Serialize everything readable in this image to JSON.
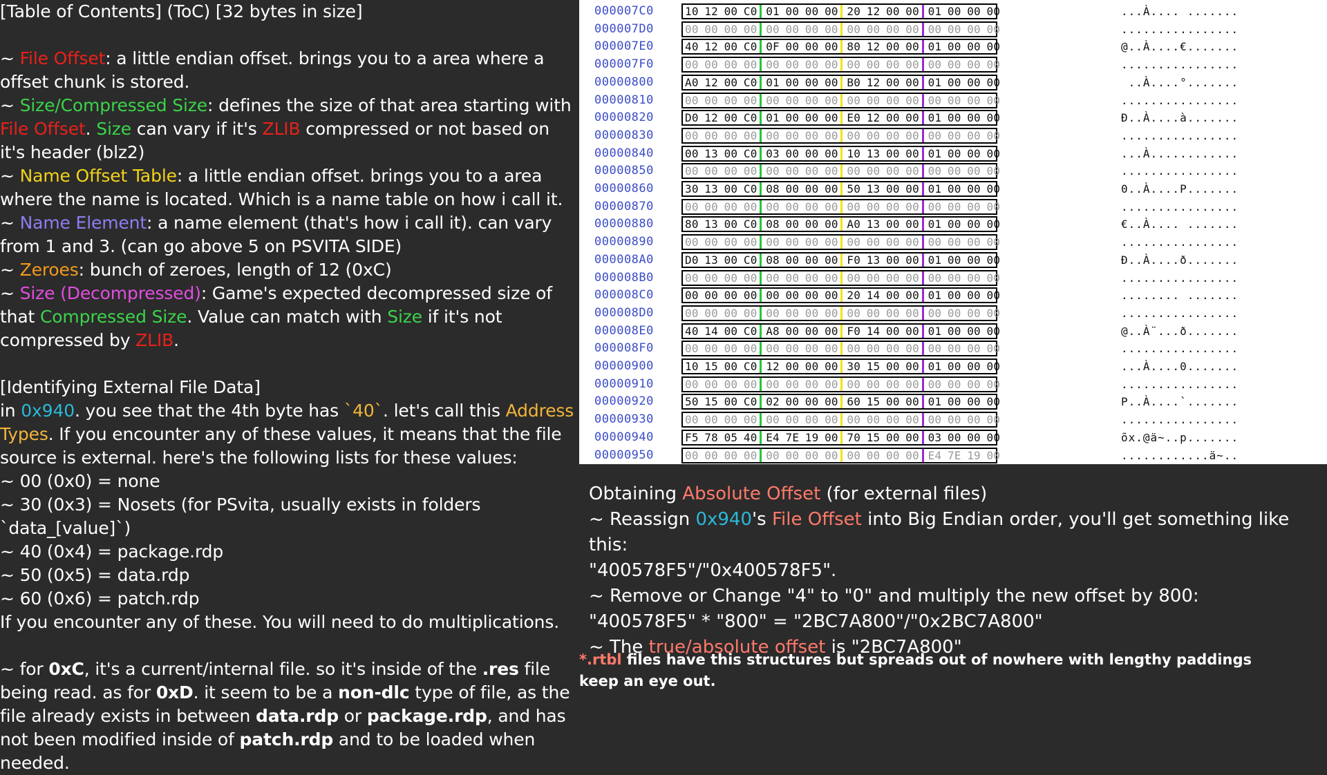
{
  "left_text": {
    "toc_header": "[Table of Contents] (ToC) [32 bytes in size]",
    "file_offset_term": "File Offset",
    "file_offset_desc": ": a little endian offset. brings you to a area where a offset chunk is stored.",
    "size_term": "Size/Compressed Size",
    "size_desc_1": ": defines the size of that area starting with ",
    "size_file_offset": "File Offset",
    "size_dot": ". ",
    "size_word": "Size",
    "size_desc_2": " can vary if it's ",
    "size_zlib": "ZLIB",
    "size_desc_3": " compressed or not based on it's header (blz2)",
    "name_offset_term": "Name Offset Table",
    "name_offset_desc": ": a little endian offset. brings you to a area where the name is located. Which is a name table on how i call it.",
    "name_element_term": "Name Element",
    "name_element_desc": ": a name element (that's how i call it). can vary from 1 and 3. (can go above 5 on PSVITA SIDE)",
    "zeroes_term": "Zeroes",
    "zeroes_desc": ": bunch of zeroes, length of 12 (0xC)",
    "decomp_term": "Size (Decompressed)",
    "decomp_desc_1": ": Game's expected decompressed size of that ",
    "decomp_compressed": "Compressed Size",
    "decomp_desc_2": ". Value can match with ",
    "decomp_size": "Size",
    "decomp_desc_3": " if it's not compressed by ",
    "decomp_zlib": "ZLIB",
    "decomp_end": ".",
    "ext_header": "[Identifying External File Data]",
    "ext_in": "in ",
    "ext_addr": "0x940",
    "ext_1": ". you see that the 4th byte has ",
    "ext_40": "`40`",
    "ext_2": ". let's call this ",
    "ext_addr_types": "Address Types",
    "ext_3": ". If you encounter any of these values, it means that the file source is external. here's the following lists for these values:",
    "list": [
      "~ 00 (0x0) = none",
      "~ 30 (0x3) = Nosets (for PSvita, usually exists in folders `data_[value]`)",
      "~ 40 (0x4) = package.rdp",
      "~ 50 (0x5) = data.rdp",
      "~ 60 (0x6) = patch.rdp"
    ],
    "mult_note": "If you encounter any of these. You will need to do multiplications.",
    "oxc_1": "~ for ",
    "oxc_b1": "0xC",
    "oxc_2": ", it's a current/internal file. so it's inside of the ",
    "oxc_b2": ".res",
    "oxc_3": " file being read. as for ",
    "oxc_b3": "0xD",
    "oxc_4": ". it seem to be a ",
    "oxc_b4": "non-dlc",
    "oxc_5": " type of file, as the file already exists in between ",
    "oxc_b5": "data.rdp",
    "oxc_6": " or ",
    "oxc_b6": "package.rdp",
    "oxc_7": ", and has not been modified inside of ",
    "oxc_b7": "patch.rdp",
    "oxc_8": " and to be loaded when needed.",
    "tilde": "~ "
  },
  "hex_rows": [
    {
      "addr": "000007C0",
      "bytes": [
        "10",
        "12",
        "00",
        "C0",
        "01",
        "00",
        "00",
        "00",
        "20",
        "12",
        "00",
        "00",
        "01",
        "00",
        "00",
        "00"
      ],
      "ascii": "...À.... ......."
    },
    {
      "addr": "000007D0",
      "bytes": [
        "00",
        "00",
        "00",
        "00",
        "00",
        "00",
        "00",
        "00",
        "00",
        "00",
        "00",
        "00",
        "00",
        "00",
        "00",
        "00"
      ],
      "ascii": "................"
    },
    {
      "addr": "000007E0",
      "bytes": [
        "40",
        "12",
        "00",
        "C0",
        "0F",
        "00",
        "00",
        "00",
        "80",
        "12",
        "00",
        "00",
        "01",
        "00",
        "00",
        "00"
      ],
      "ascii": "@..À....€......."
    },
    {
      "addr": "000007F0",
      "bytes": [
        "00",
        "00",
        "00",
        "00",
        "00",
        "00",
        "00",
        "00",
        "00",
        "00",
        "00",
        "00",
        "00",
        "00",
        "00",
        "00"
      ],
      "ascii": "................"
    },
    {
      "addr": "00000800",
      "bytes": [
        "A0",
        "12",
        "00",
        "C0",
        "01",
        "00",
        "00",
        "00",
        "B0",
        "12",
        "00",
        "00",
        "01",
        "00",
        "00",
        "00"
      ],
      "ascii": " ..À....°......."
    },
    {
      "addr": "00000810",
      "bytes": [
        "00",
        "00",
        "00",
        "00",
        "00",
        "00",
        "00",
        "00",
        "00",
        "00",
        "00",
        "00",
        "00",
        "00",
        "00",
        "00"
      ],
      "ascii": "................"
    },
    {
      "addr": "00000820",
      "bytes": [
        "D0",
        "12",
        "00",
        "C0",
        "01",
        "00",
        "00",
        "00",
        "E0",
        "12",
        "00",
        "00",
        "01",
        "00",
        "00",
        "00"
      ],
      "ascii": "Ð..À....à......."
    },
    {
      "addr": "00000830",
      "bytes": [
        "00",
        "00",
        "00",
        "00",
        "00",
        "00",
        "00",
        "00",
        "00",
        "00",
        "00",
        "00",
        "00",
        "00",
        "00",
        "00"
      ],
      "ascii": "................"
    },
    {
      "addr": "00000840",
      "bytes": [
        "00",
        "13",
        "00",
        "C0",
        "03",
        "00",
        "00",
        "00",
        "10",
        "13",
        "00",
        "00",
        "01",
        "00",
        "00",
        "00"
      ],
      "ascii": "...À............"
    },
    {
      "addr": "00000850",
      "bytes": [
        "00",
        "00",
        "00",
        "00",
        "00",
        "00",
        "00",
        "00",
        "00",
        "00",
        "00",
        "00",
        "00",
        "00",
        "00",
        "00"
      ],
      "ascii": "................"
    },
    {
      "addr": "00000860",
      "bytes": [
        "30",
        "13",
        "00",
        "C0",
        "08",
        "00",
        "00",
        "00",
        "50",
        "13",
        "00",
        "00",
        "01",
        "00",
        "00",
        "00"
      ],
      "ascii": "0..À....P......."
    },
    {
      "addr": "00000870",
      "bytes": [
        "00",
        "00",
        "00",
        "00",
        "00",
        "00",
        "00",
        "00",
        "00",
        "00",
        "00",
        "00",
        "00",
        "00",
        "00",
        "00"
      ],
      "ascii": "................"
    },
    {
      "addr": "00000880",
      "bytes": [
        "80",
        "13",
        "00",
        "C0",
        "08",
        "00",
        "00",
        "00",
        "A0",
        "13",
        "00",
        "00",
        "01",
        "00",
        "00",
        "00"
      ],
      "ascii": "€..À.... ......."
    },
    {
      "addr": "00000890",
      "bytes": [
        "00",
        "00",
        "00",
        "00",
        "00",
        "00",
        "00",
        "00",
        "00",
        "00",
        "00",
        "00",
        "00",
        "00",
        "00",
        "00"
      ],
      "ascii": "................"
    },
    {
      "addr": "000008A0",
      "bytes": [
        "D0",
        "13",
        "00",
        "C0",
        "08",
        "00",
        "00",
        "00",
        "F0",
        "13",
        "00",
        "00",
        "01",
        "00",
        "00",
        "00"
      ],
      "ascii": "Ð..À....ð......."
    },
    {
      "addr": "000008B0",
      "bytes": [
        "00",
        "00",
        "00",
        "00",
        "00",
        "00",
        "00",
        "00",
        "00",
        "00",
        "00",
        "00",
        "00",
        "00",
        "00",
        "00"
      ],
      "ascii": "................"
    },
    {
      "addr": "000008C0",
      "bytes": [
        "00",
        "00",
        "00",
        "00",
        "00",
        "00",
        "00",
        "00",
        "20",
        "14",
        "00",
        "00",
        "01",
        "00",
        "00",
        "00"
      ],
      "ascii": "........ ......."
    },
    {
      "addr": "000008D0",
      "bytes": [
        "00",
        "00",
        "00",
        "00",
        "00",
        "00",
        "00",
        "00",
        "00",
        "00",
        "00",
        "00",
        "00",
        "00",
        "00",
        "00"
      ],
      "ascii": "................"
    },
    {
      "addr": "000008E0",
      "bytes": [
        "40",
        "14",
        "00",
        "C0",
        "A8",
        "00",
        "00",
        "00",
        "F0",
        "14",
        "00",
        "00",
        "01",
        "00",
        "00",
        "00"
      ],
      "ascii": "@..À¨...ð......."
    },
    {
      "addr": "000008F0",
      "bytes": [
        "00",
        "00",
        "00",
        "00",
        "00",
        "00",
        "00",
        "00",
        "00",
        "00",
        "00",
        "00",
        "00",
        "00",
        "00",
        "00"
      ],
      "ascii": "................"
    },
    {
      "addr": "00000900",
      "bytes": [
        "10",
        "15",
        "00",
        "C0",
        "12",
        "00",
        "00",
        "00",
        "30",
        "15",
        "00",
        "00",
        "01",
        "00",
        "00",
        "00"
      ],
      "ascii": "...À....0......."
    },
    {
      "addr": "00000910",
      "bytes": [
        "00",
        "00",
        "00",
        "00",
        "00",
        "00",
        "00",
        "00",
        "00",
        "00",
        "00",
        "00",
        "00",
        "00",
        "00",
        "00"
      ],
      "ascii": "................"
    },
    {
      "addr": "00000920",
      "bytes": [
        "50",
        "15",
        "00",
        "C0",
        "02",
        "00",
        "00",
        "00",
        "60",
        "15",
        "00",
        "00",
        "01",
        "00",
        "00",
        "00"
      ],
      "ascii": "P..À....`......."
    },
    {
      "addr": "00000930",
      "bytes": [
        "00",
        "00",
        "00",
        "00",
        "00",
        "00",
        "00",
        "00",
        "00",
        "00",
        "00",
        "00",
        "00",
        "00",
        "00",
        "00"
      ],
      "ascii": "................"
    },
    {
      "addr": "00000940",
      "bytes": [
        "F5",
        "78",
        "05",
        "40",
        "E4",
        "7E",
        "19",
        "00",
        "70",
        "15",
        "00",
        "00",
        "03",
        "00",
        "00",
        "00"
      ],
      "ascii": "õx.@ä~..p......."
    },
    {
      "addr": "00000950",
      "bytes": [
        "00",
        "00",
        "00",
        "00",
        "00",
        "00",
        "00",
        "00",
        "00",
        "00",
        "00",
        "00",
        "E4",
        "7E",
        "19",
        "00"
      ],
      "ascii": "............ä~.."
    }
  ],
  "separator_colors": [
    "#22c63a",
    "#f2e21b",
    "#9a2bd8"
  ],
  "right_text": {
    "title_1": "Obtaining ",
    "title_abs": "Absolute Offset",
    "title_2": " (for external files)",
    "l1_1": "~ Reassign ",
    "l1_addr": "0x940",
    "l1_2": "'s ",
    "l1_fo": "File Offset",
    "l1_3": " into Big Endian order, you'll get something like this:",
    "l2": "\"400578F5\"/\"0x400578F5\".",
    "l3": "~ Remove or Change \"4\" to \"0\" and multiply the new offset by 800:",
    "l4": "\"400578F5\" * \"800\" = \"2BC7A800\"/\"0x2BC7A800\"",
    "l5_1": "~ The ",
    "l5_true": "true/absolute offset",
    "l5_2": " is \"2BC7A800\""
  },
  "notes": {
    "rtbl": "*.rtbl",
    "line1": " files have this structures but spreads out of nowhere with lengthy paddings",
    "line2": "keep an eye out."
  }
}
